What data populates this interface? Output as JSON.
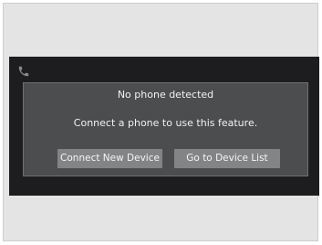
{
  "dialog": {
    "title": "No phone detected",
    "message": "Connect a phone to use this feature.",
    "connect_button_label": "Connect New Device",
    "device_list_button_label": "Go to Device List"
  },
  "status": {
    "icon": "phone-icon"
  }
}
